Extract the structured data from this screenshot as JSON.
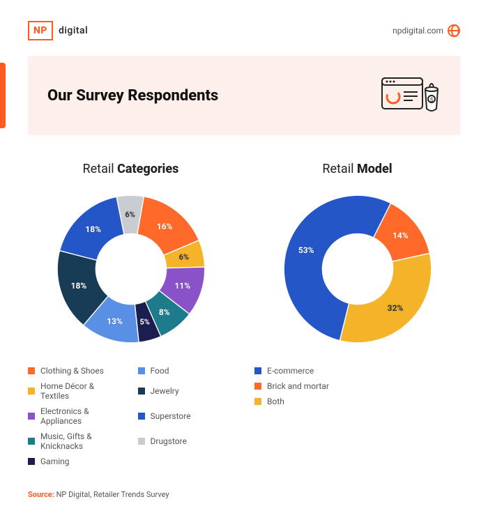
{
  "brand": {
    "box": "NP",
    "word": "digital",
    "url": "npdigital.com"
  },
  "hero": {
    "title": "Our Survey Respondents"
  },
  "charts": {
    "categories": {
      "title_light": "Retail ",
      "title_bold": "Categories"
    },
    "model": {
      "title_light": "Retail ",
      "title_bold": "Model"
    }
  },
  "chart_data": [
    {
      "type": "pie",
      "title": "Retail Categories",
      "series": [
        {
          "name": "Clothing & Shoes",
          "value": 16,
          "color": "#ff6a2b"
        },
        {
          "name": "Home Décor & Textiles",
          "value": 6,
          "color": "#f5b32a"
        },
        {
          "name": "Electronics & Appliances",
          "value": 11,
          "color": "#8a52c9"
        },
        {
          "name": "Music, Gifts & Knicknacks",
          "value": 8,
          "color": "#1e7b8c"
        },
        {
          "name": "Gaming",
          "value": 5,
          "color": "#1b1e4e"
        },
        {
          "name": "Food",
          "value": 13,
          "color": "#5a8fe6"
        },
        {
          "name": "Jewelry",
          "value": 18,
          "color": "#183b56"
        },
        {
          "name": "Superstore",
          "value": 18,
          "color": "#2456c7"
        },
        {
          "name": "Drugstore",
          "value": 6,
          "color": "#c9ccd1"
        }
      ]
    },
    {
      "type": "pie",
      "title": "Retail Model",
      "series": [
        {
          "name": "E-commerce",
          "value": 53,
          "color": "#2456c7"
        },
        {
          "name": "Brick and mortar",
          "value": 14,
          "color": "#ff6a2b"
        },
        {
          "name": "Both",
          "value": 32,
          "color": "#f5b32a"
        }
      ]
    }
  ],
  "source": {
    "label": "Source:",
    "text": " NP Digital, Retailer Trends Survey"
  }
}
